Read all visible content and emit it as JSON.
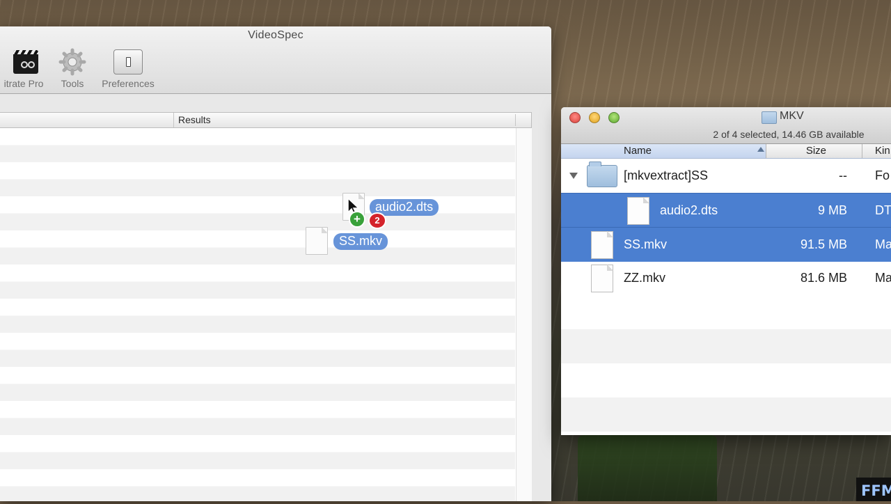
{
  "videospec": {
    "title": "VideoSpec",
    "toolbar": [
      {
        "label": "itrate Pro",
        "icon": "clapperboard-gears-icon"
      },
      {
        "label": "Tools",
        "icon": "gear-icon"
      },
      {
        "label": "Preferences",
        "icon": "switch-icon"
      }
    ],
    "results_header": "Results"
  },
  "drag": {
    "items": [
      {
        "label": "audio2.dts"
      },
      {
        "label": "SS.mkv"
      }
    ],
    "count_badge": "2",
    "plus_badge": "+"
  },
  "finder": {
    "title": "MKV",
    "status": "2 of 4 selected, 14.46 GB available",
    "columns": {
      "name": "Name",
      "size": "Size",
      "kind": "Kin"
    },
    "rows": [
      {
        "name": "[mkvextract]SS",
        "size": "--",
        "kind": "Fo",
        "selected": false,
        "type": "folder",
        "expanded": true
      },
      {
        "name": "audio2.dts",
        "size": "9 MB",
        "kind": "DT",
        "selected": true,
        "type": "document"
      },
      {
        "name": "SS.mkv",
        "size": "91.5 MB",
        "kind": "Ma",
        "selected": true,
        "type": "document"
      },
      {
        "name": "ZZ.mkv",
        "size": "81.6 MB",
        "kind": "Ma",
        "selected": false,
        "type": "document"
      }
    ]
  },
  "watermark": {
    "text": "FFM"
  },
  "colors": {
    "selection": "#4b7fd0",
    "drag_label": "#5b8bd6",
    "badge_red": "#d4232b",
    "badge_green": "#39a13a"
  }
}
